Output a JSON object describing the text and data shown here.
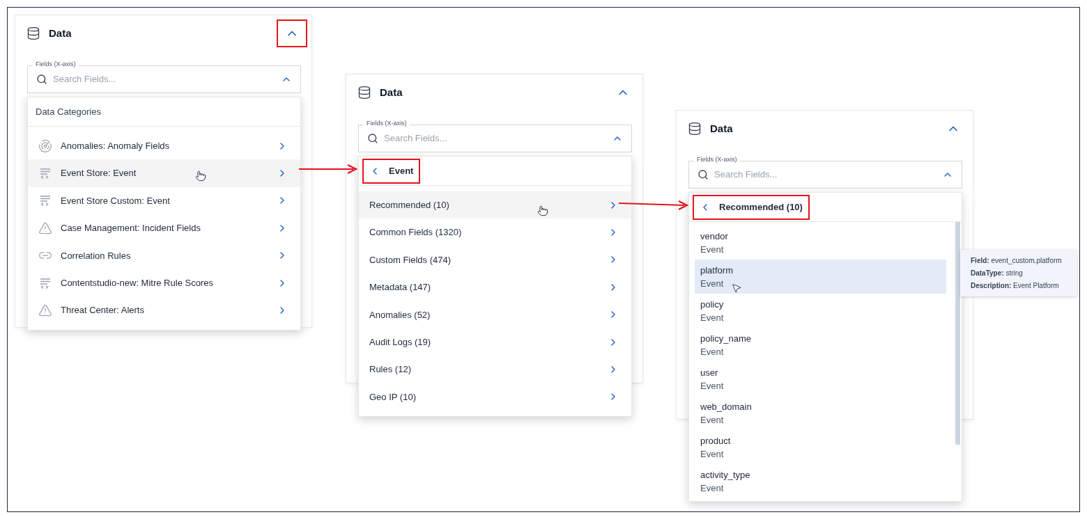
{
  "panels": [
    {
      "title": "Data",
      "collapse_highlighted": true,
      "field_label": "Fields (X-axis)",
      "search_placeholder": "Search Fields...",
      "menu": {
        "kind": "categories",
        "header": "Data Categories",
        "header_highlighted": false,
        "items": [
          {
            "label": "Anomalies: Anomaly Fields",
            "kind": "radar",
            "hovered": false
          },
          {
            "label": "Event Store: Event",
            "kind": "event",
            "hovered": true
          },
          {
            "label": "Event Store Custom: Event",
            "kind": "event",
            "hovered": false
          },
          {
            "label": "Case Management: Incident Fields",
            "kind": "warning",
            "hovered": false
          },
          {
            "label": "Correlation Rules",
            "kind": "link",
            "hovered": false
          },
          {
            "label": "Contentstudio-new: Mitre Rule Scores",
            "kind": "event",
            "hovered": false
          },
          {
            "label": "Threat Center: Alerts",
            "kind": "warning",
            "hovered": false
          }
        ]
      }
    },
    {
      "title": "Data",
      "collapse_highlighted": false,
      "field_label": "Fields (X-axis)",
      "search_placeholder": "Search Fields...",
      "menu": {
        "kind": "groups",
        "header": "Event",
        "header_highlighted": true,
        "items": [
          {
            "label": "Recommended (10)",
            "hovered": true
          },
          {
            "label": "Common Fields (1320)",
            "hovered": false
          },
          {
            "label": "Custom Fields (474)",
            "hovered": false
          },
          {
            "label": "Metadata (147)",
            "hovered": false
          },
          {
            "label": "Anomalies (52)",
            "hovered": false
          },
          {
            "label": "Audit Logs (19)",
            "hovered": false
          },
          {
            "label": "Rules (12)",
            "hovered": false
          },
          {
            "label": "Geo IP (10)",
            "hovered": false
          }
        ]
      }
    },
    {
      "title": "Data",
      "collapse_highlighted": false,
      "field_label": "Fields (X-axis)",
      "search_placeholder": "Search Fields...",
      "menu": {
        "kind": "fields",
        "header": "Recommended (10)",
        "header_highlighted": true,
        "items": [
          {
            "name": "vendor",
            "source": "Event",
            "selected": false
          },
          {
            "name": "platform",
            "source": "Event",
            "selected": true
          },
          {
            "name": "policy",
            "source": "Event",
            "selected": false
          },
          {
            "name": "policy_name",
            "source": "Event",
            "selected": false
          },
          {
            "name": "user",
            "source": "Event",
            "selected": false
          },
          {
            "name": "web_domain",
            "source": "Event",
            "selected": false
          },
          {
            "name": "product",
            "source": "Event",
            "selected": false
          },
          {
            "name": "activity_type",
            "source": "Event",
            "selected": false
          }
        ]
      },
      "tooltip": {
        "lines": [
          "**Field:** event_custom.platform",
          "**DataType:** string",
          "**Description:** Event Platform"
        ]
      }
    }
  ]
}
